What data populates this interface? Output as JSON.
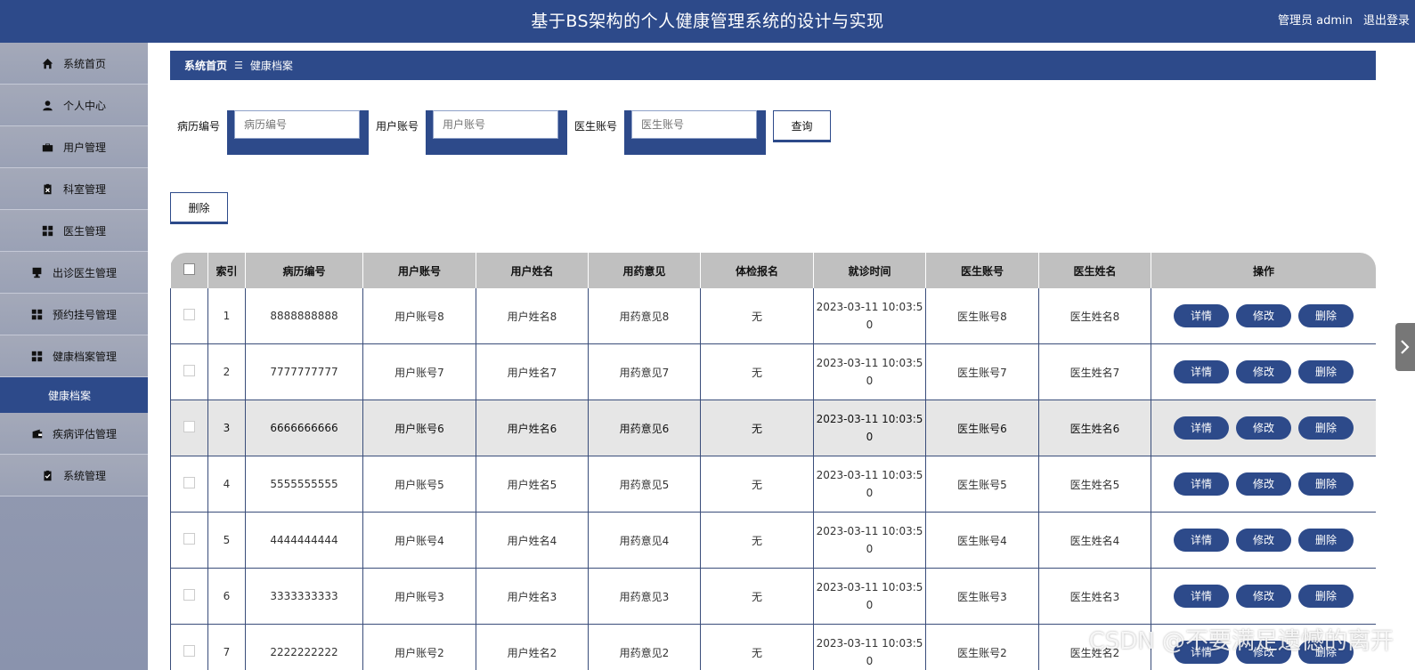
{
  "header": {
    "title": "基于BS架构的个人健康管理系统的设计与实现",
    "user_label": "管理员 admin",
    "logout_label": "退出登录"
  },
  "sidebar": {
    "items": [
      {
        "label": "系统首页",
        "icon": "home-icon"
      },
      {
        "label": "个人中心",
        "icon": "user-icon"
      },
      {
        "label": "用户管理",
        "icon": "briefcase-icon"
      },
      {
        "label": "科室管理",
        "icon": "clipboard-icon"
      },
      {
        "label": "医生管理",
        "icon": "grid-icon"
      },
      {
        "label": "出诊医生管理",
        "icon": "monitor-icon"
      },
      {
        "label": "预约挂号管理",
        "icon": "grid-icon"
      },
      {
        "label": "健康档案管理",
        "icon": "grid-icon"
      }
    ],
    "active_sub": "健康档案",
    "items_after": [
      {
        "label": "疾病评估管理",
        "icon": "wallet-icon"
      },
      {
        "label": "系统管理",
        "icon": "clipboard-check-icon"
      }
    ]
  },
  "breadcrumb": {
    "home": "系统首页",
    "sep": "☰",
    "current": "健康档案"
  },
  "search": {
    "fields": [
      {
        "label": "病历编号",
        "placeholder": "病历编号"
      },
      {
        "label": "用户账号",
        "placeholder": "用户账号"
      },
      {
        "label": "医生账号",
        "placeholder": "医生账号"
      }
    ],
    "query_label": "查询",
    "delete_label": "删除"
  },
  "table": {
    "columns": [
      "索引",
      "病历编号",
      "用户账号",
      "用户姓名",
      "用药意见",
      "体检报名",
      "就诊时间",
      "医生账号",
      "医生姓名",
      "操作"
    ],
    "actions": [
      "详情",
      "修改",
      "删除"
    ],
    "rows": [
      {
        "idx": "1",
        "record": "8888888888",
        "account": "用户账号8",
        "name": "用户姓名8",
        "advice": "用药意见8",
        "exam": "无",
        "time_a": "2023-03-11 10:03:5",
        "time_b": "0",
        "doc_account": "医生账号8",
        "doc_name": "医生姓名8"
      },
      {
        "idx": "2",
        "record": "7777777777",
        "account": "用户账号7",
        "name": "用户姓名7",
        "advice": "用药意见7",
        "exam": "无",
        "time_a": "2023-03-11 10:03:5",
        "time_b": "0",
        "doc_account": "医生账号7",
        "doc_name": "医生姓名7"
      },
      {
        "idx": "3",
        "record": "6666666666",
        "account": "用户账号6",
        "name": "用户姓名6",
        "advice": "用药意见6",
        "exam": "无",
        "time_a": "2023-03-11 10:03:5",
        "time_b": "0",
        "doc_account": "医生账号6",
        "doc_name": "医生姓名6"
      },
      {
        "idx": "4",
        "record": "5555555555",
        "account": "用户账号5",
        "name": "用户姓名5",
        "advice": "用药意见5",
        "exam": "无",
        "time_a": "2023-03-11 10:03:5",
        "time_b": "0",
        "doc_account": "医生账号5",
        "doc_name": "医生姓名5"
      },
      {
        "idx": "5",
        "record": "4444444444",
        "account": "用户账号4",
        "name": "用户姓名4",
        "advice": "用药意见4",
        "exam": "无",
        "time_a": "2023-03-11 10:03:5",
        "time_b": "0",
        "doc_account": "医生账号4",
        "doc_name": "医生姓名4"
      },
      {
        "idx": "6",
        "record": "3333333333",
        "account": "用户账号3",
        "name": "用户姓名3",
        "advice": "用药意见3",
        "exam": "无",
        "time_a": "2023-03-11 10:03:5",
        "time_b": "0",
        "doc_account": "医生账号3",
        "doc_name": "医生姓名3"
      },
      {
        "idx": "7",
        "record": "2222222222",
        "account": "用户账号2",
        "name": "用户姓名2",
        "advice": "用药意见2",
        "exam": "无",
        "time_a": "2023-03-11 10:03:5",
        "time_b": "0",
        "doc_account": "医生账号2",
        "doc_name": "医生姓名2"
      }
    ]
  },
  "watermark": "CSDN @不要满足遗憾的离开",
  "colors": {
    "primary": "#2d4a8a",
    "header_gray": "#c0c0c0"
  }
}
